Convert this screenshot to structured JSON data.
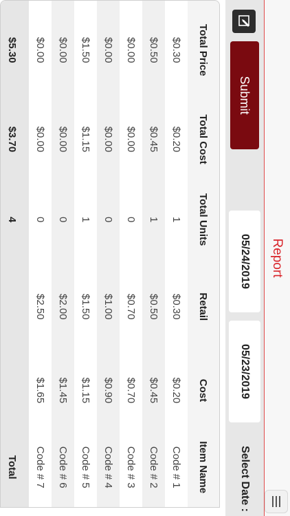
{
  "nav": {
    "title": "Report",
    "menu_icon": "menu-icon"
  },
  "toolbar": {
    "edit_icon": "edit-icon",
    "submit_label": "Submit",
    "select_date_label": "Select Date :",
    "date_from": "05/23/2019",
    "date_to": "05/24/2019"
  },
  "table": {
    "headers": [
      "Item Name",
      "Cost",
      "Retail",
      "Total Units",
      "Total Cost",
      "Total Price"
    ],
    "rows": [
      [
        "Code # 1",
        "$0.20",
        "$0.30",
        "1",
        "$0.20",
        "$0.30"
      ],
      [
        "Code # 2",
        "$0.45",
        "$0.50",
        "1",
        "$0.45",
        "$0.50"
      ],
      [
        "Code # 3",
        "$0.70",
        "$0.70",
        "0",
        "$0.00",
        "$0.00"
      ],
      [
        "Code # 4",
        "$0.90",
        "$1.00",
        "0",
        "$0.00",
        "$0.00"
      ],
      [
        "Code # 5",
        "$1.15",
        "$1.50",
        "1",
        "$1.15",
        "$1.50"
      ],
      [
        "Code # 6",
        "$1.45",
        "$2.00",
        "0",
        "$0.00",
        "$0.00"
      ],
      [
        "Code # 7",
        "$1.65",
        "$2.50",
        "0",
        "$0.00",
        "$0.00"
      ]
    ],
    "total": {
      "label": "Total",
      "units": "4",
      "cost": "$3.70",
      "price": "$5.30"
    }
  },
  "colors": {
    "accent_red": "#d9262c",
    "submit_bg": "#7a0a10"
  }
}
